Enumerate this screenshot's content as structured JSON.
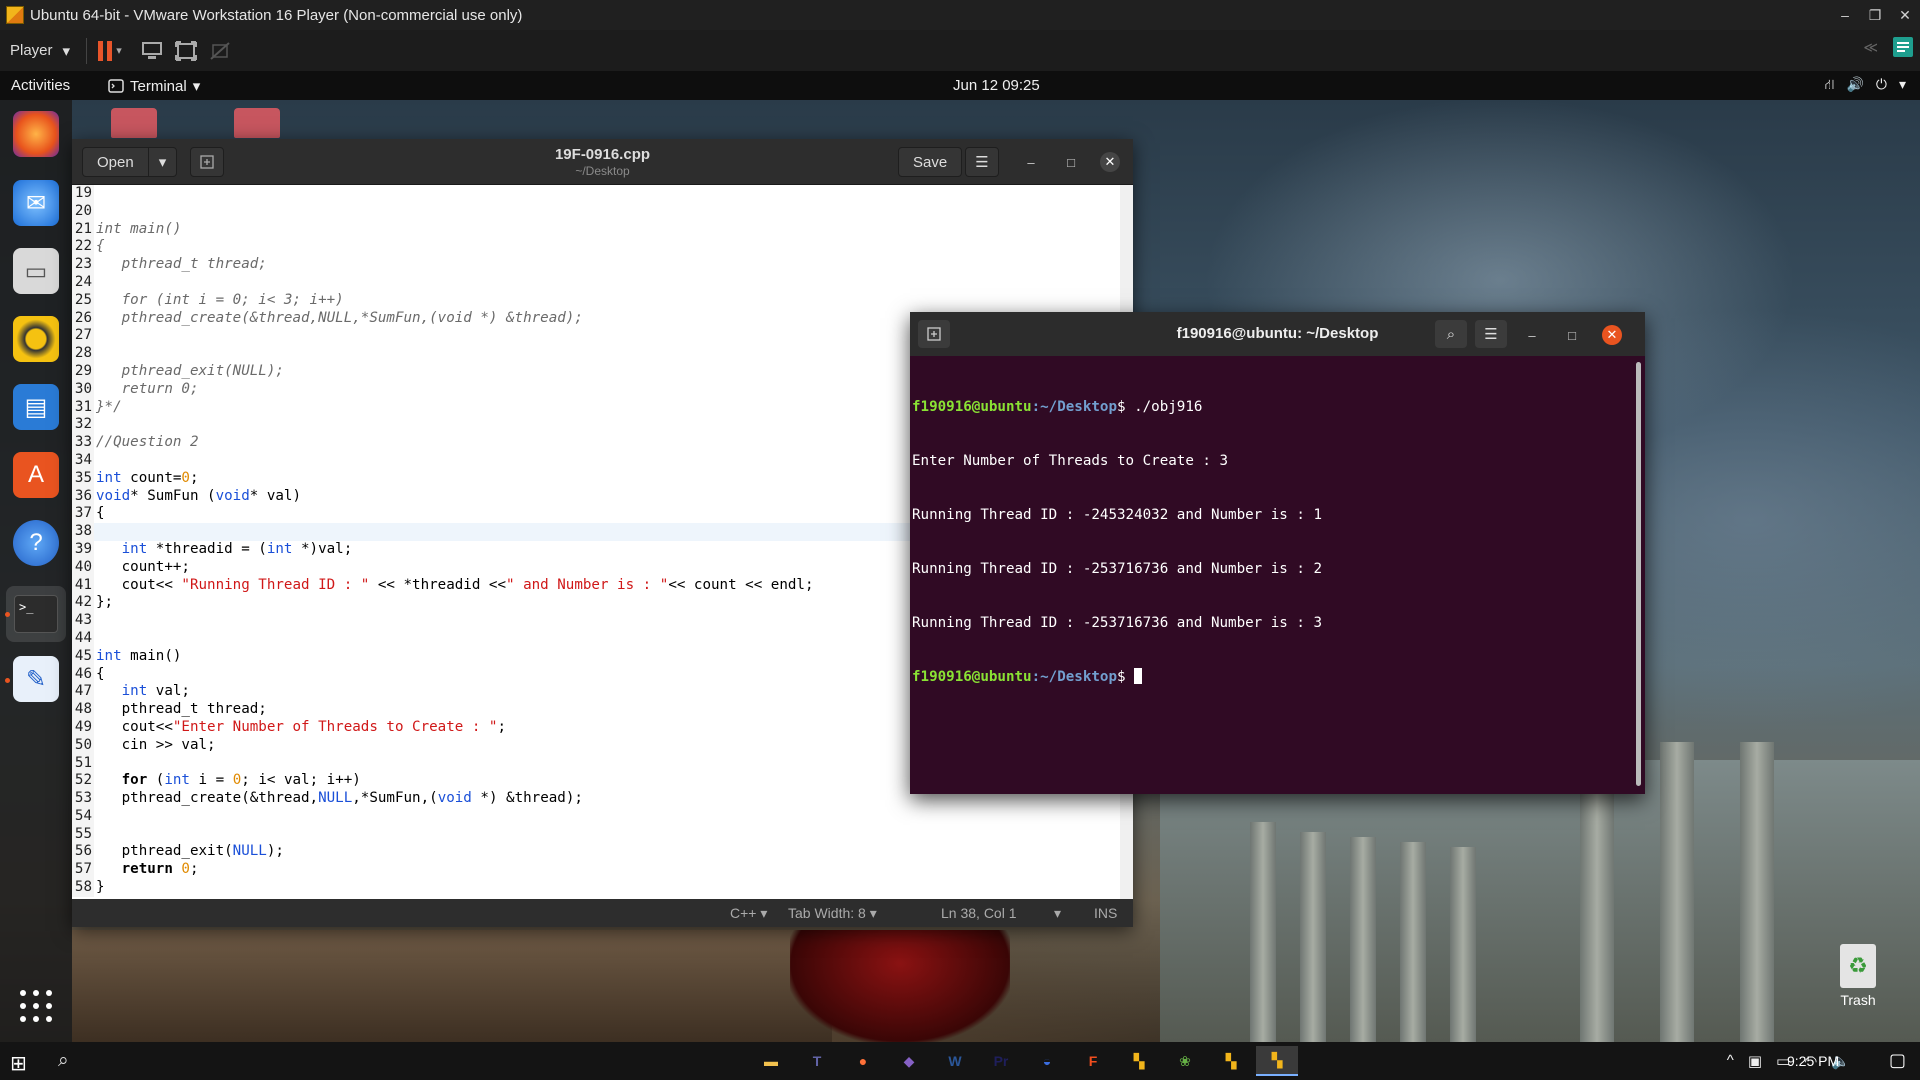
{
  "vmware": {
    "title": "Ubuntu 64-bit - VMware Workstation 16 Player (Non-commercial use only)",
    "player_label": "Player",
    "win_min": "–",
    "win_restore": "❐",
    "win_close": "✕"
  },
  "gnome": {
    "activities": "Activities",
    "app_menu": "Terminal",
    "clock": "Jun 12  09:25"
  },
  "gedit": {
    "open_label": "Open",
    "title": "19F-0916.cpp",
    "subtitle": "~/Desktop",
    "save_label": "Save",
    "status": {
      "language": "C++",
      "tab_width": "Tab Width: 8",
      "position": "Ln 38, Col 1",
      "mode": "INS"
    },
    "code_lines": [
      {
        "n": "19",
        "text": ""
      },
      {
        "n": "20",
        "text": ""
      },
      {
        "n": "21",
        "text": "int main()"
      },
      {
        "n": "22",
        "text": "{"
      },
      {
        "n": "23",
        "text": "   pthread_t thread;"
      },
      {
        "n": "24",
        "text": ""
      },
      {
        "n": "25",
        "text": "   for (int i = 0; i< 3; i++)"
      },
      {
        "n": "26",
        "text": "   pthread_create(&thread,NULL,*SumFun,(void *) &thread);"
      },
      {
        "n": "27",
        "text": ""
      },
      {
        "n": "28",
        "text": ""
      },
      {
        "n": "29",
        "text": "   pthread_exit(NULL);"
      },
      {
        "n": "30",
        "text": "   return 0;"
      },
      {
        "n": "31",
        "text": "}*/"
      },
      {
        "n": "32",
        "text": ""
      },
      {
        "n": "33",
        "text": "//Question 2"
      },
      {
        "n": "34",
        "text": ""
      },
      {
        "n": "35",
        "text": "int count=0;"
      },
      {
        "n": "36",
        "text": "void* SumFun (void* val)"
      },
      {
        "n": "37",
        "text": "{"
      },
      {
        "n": "38",
        "text": ""
      },
      {
        "n": "39",
        "text": "   int *threadid = (int *)val;"
      },
      {
        "n": "40",
        "text": "   count++;"
      },
      {
        "n": "41",
        "text": "   cout<< \"Running Thread ID : \" << *threadid <<\" and Number is : \"<< count << endl;"
      },
      {
        "n": "42",
        "text": "};"
      },
      {
        "n": "43",
        "text": ""
      },
      {
        "n": "44",
        "text": ""
      },
      {
        "n": "45",
        "text": "int main()"
      },
      {
        "n": "46",
        "text": "{"
      },
      {
        "n": "47",
        "text": "   int val;"
      },
      {
        "n": "48",
        "text": "   pthread_t thread;"
      },
      {
        "n": "49",
        "text": "   cout<<\"Enter Number of Threads to Create : \";"
      },
      {
        "n": "50",
        "text": "   cin >> val;"
      },
      {
        "n": "51",
        "text": ""
      },
      {
        "n": "52",
        "text": "   for (int i = 0; i< val; i++)"
      },
      {
        "n": "53",
        "text": "   pthread_create(&thread,NULL,*SumFun,(void *) &thread);"
      },
      {
        "n": "54",
        "text": ""
      },
      {
        "n": "55",
        "text": ""
      },
      {
        "n": "56",
        "text": "   pthread_exit(NULL);"
      },
      {
        "n": "57",
        "text": "   return 0;"
      },
      {
        "n": "58",
        "text": "}"
      }
    ]
  },
  "terminal": {
    "title": "f190916@ubuntu: ~/Desktop",
    "prompt_user": "f190916@ubuntu",
    "prompt_path": ":~/Desktop",
    "prompt_symbol": "$",
    "command": " ./obj916",
    "output": [
      "Enter Number of Threads to Create : 3",
      "Running Thread ID : -245324032 and Number is : 1",
      "Running Thread ID : -253716736 and Number is : 2",
      "Running Thread ID : -253716736 and Number is : 3"
    ]
  },
  "desktop": {
    "trash_label": "Trash"
  },
  "taskbar": {
    "time": "9:25 PM",
    "apps": [
      "Files",
      "Teams",
      "Firefox",
      "Visual Studio",
      "Word",
      "Premiere",
      "Vault",
      "Figma",
      "VMware",
      "Utility",
      "Ubuntu VM",
      "VMware Player"
    ]
  },
  "colors": {
    "ubuntu_orange": "#e95420",
    "terminal_bg": "#300a24",
    "prompt_green": "#8ae234",
    "prompt_blue": "#729fcf",
    "code_keyword": "#1a4fd8",
    "code_string": "#d01818",
    "code_number": "#e08a00"
  }
}
